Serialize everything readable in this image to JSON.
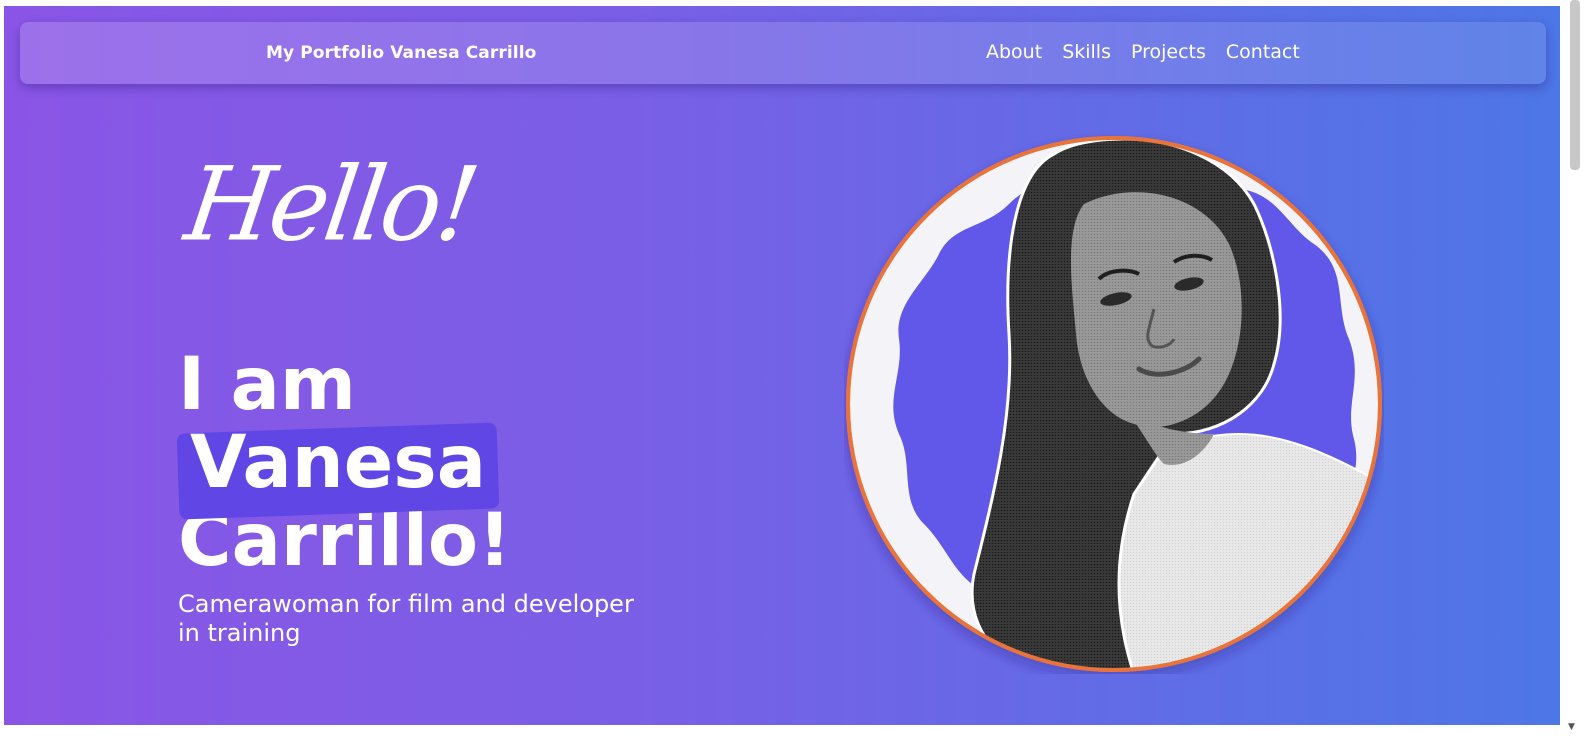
{
  "navbar": {
    "brand": "My Portfolio Vanesa Carrillo",
    "links": [
      "About",
      "Skills",
      "Projects",
      "Contact"
    ]
  },
  "hero": {
    "greeting": "Hello!",
    "title_line1": "I am",
    "title_highlight": "Vanesa",
    "title_line3": "Carrillo!",
    "subtitle": "Camerawoman for film and developer in training"
  },
  "portrait": {
    "icon": "profile-photo-grayscale",
    "ring_color": "#e8743b",
    "blob_color": "#6157e8",
    "background_color": "#f4f4f8"
  },
  "colors": {
    "gradient_start": "#8a55e6",
    "gradient_end": "#4d76e6",
    "highlight": "#6146e6"
  }
}
